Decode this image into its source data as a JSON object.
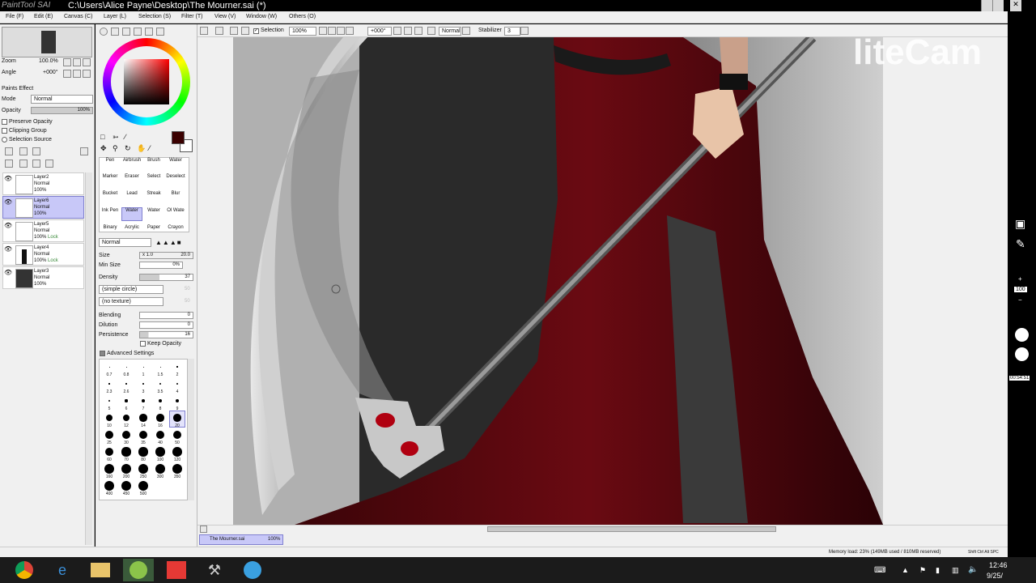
{
  "window": {
    "app_logo": "PaintTool SAI",
    "title": "C:\\Users\\Alice Payne\\Desktop\\The Mourner.sai (*)"
  },
  "menu": [
    "File (F)",
    "Edit (E)",
    "Canvas (C)",
    "Layer (L)",
    "Selection (S)",
    "Filter (T)",
    "View (V)",
    "Window (W)",
    "Others (O)"
  ],
  "navigator": {
    "zoom_label": "Zoom",
    "zoom_value": "100.0%",
    "angle_label": "Angle",
    "angle_value": "+000°"
  },
  "layer_props": {
    "paints_effect": "Paints Effect",
    "mode_label": "Mode",
    "mode_value": "Normal",
    "opacity_label": "Opacity",
    "opacity_value": "100%",
    "preserve_opacity": "Preserve Opacity",
    "clipping_group": "Clipping Group",
    "selection_source": "Selection Source"
  },
  "layers": [
    {
      "name": "Layer2",
      "mode": "Normal",
      "opacity": "100%",
      "lock": ""
    },
    {
      "name": "Layer6",
      "mode": "Normal",
      "opacity": "100%",
      "lock": ""
    },
    {
      "name": "Layer5",
      "mode": "Normal",
      "opacity": "100%",
      "lock": "Lock"
    },
    {
      "name": "Layer4",
      "mode": "Normal",
      "opacity": "100%",
      "lock": "Lock"
    },
    {
      "name": "Layer3",
      "mode": "Normal",
      "opacity": "100%",
      "lock": ""
    }
  ],
  "colors": {
    "primary": "#3a0000",
    "secondary": "#ffffff",
    "selected_layer_bg": "#c8c8f8"
  },
  "tools": [
    [
      "Pen",
      "Airbrush",
      "Brush",
      "Water"
    ],
    [
      "Marker",
      "Eraser",
      "Select",
      "Deselect"
    ],
    [
      "Bucket",
      "Lead",
      "Streak",
      "Blur"
    ],
    [
      "Ink Pen",
      "Water",
      "Water",
      "Ol Wate"
    ],
    [
      "Binary",
      "Acrylic",
      "Paper",
      "Crayon"
    ]
  ],
  "brush": {
    "mode": "Normal",
    "size_label": "Size",
    "size_mult": "x 1.0",
    "size_value": "20.0",
    "min_size_label": "Min Size",
    "min_size_value": "0%",
    "density_label": "Density",
    "density_value": "37",
    "shape": "(simple circle)",
    "shape_val": "50",
    "texture": "(no texture)",
    "texture_val": "50",
    "blending_label": "Blending",
    "blending_value": "0",
    "dilution_label": "Dilution",
    "dilution_value": "0",
    "persistence_label": "Persistence",
    "persistence_value": "16",
    "keep_opacity": "Keep Opacity",
    "advanced": "Advanced Settings"
  },
  "brush_sizes": [
    [
      "0.7",
      "0.8",
      "1",
      "1.5",
      "2"
    ],
    [
      "2.3",
      "2.6",
      "3",
      "3.5",
      "4"
    ],
    [
      "5",
      "6",
      "7",
      "8",
      "9"
    ],
    [
      "10",
      "12",
      "14",
      "16",
      "20"
    ],
    [
      "25",
      "30",
      "35",
      "40",
      "50"
    ],
    [
      "60",
      "70",
      "80",
      "100",
      "120"
    ],
    [
      "160",
      "200",
      "250",
      "300",
      "350"
    ],
    [
      "400",
      "450",
      "500"
    ]
  ],
  "toolbar": {
    "selection": "Selection",
    "zoom": "100%",
    "angle": "+000°",
    "blend": "Normal",
    "stabilizer_label": "Stabilizer",
    "stabilizer_value": "3"
  },
  "doc_tab": {
    "name": "The Mourner.sai",
    "zoom": "100%"
  },
  "status": {
    "memory": "Memory load: 23% (149MB used / 810MB reserved)",
    "keys": "Shift Ctrl Alt SPC"
  },
  "watermark": "liteCam",
  "recorder": {
    "zoom": "100",
    "time": "00:54:51"
  },
  "tray": {
    "time": "12:46",
    "date": "9/25/"
  }
}
